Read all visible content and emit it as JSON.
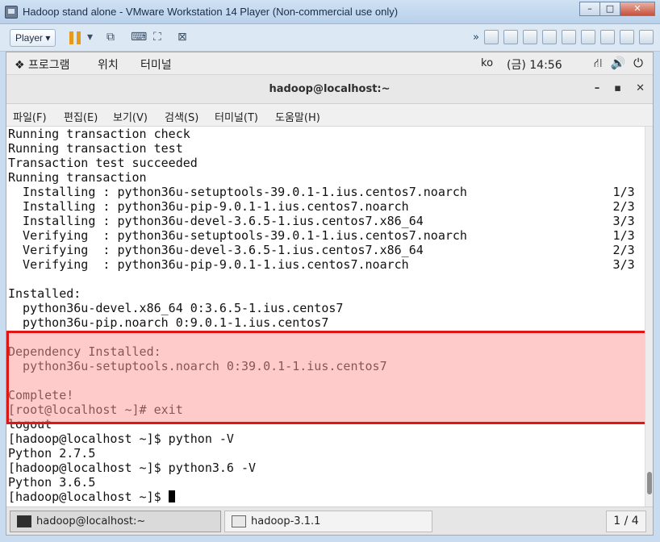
{
  "vm_window": {
    "title": "Hadoop stand alone - VMware Workstation 14 Player (Non-commercial use only)",
    "minimize": "–",
    "maximize": "□",
    "close": "✕"
  },
  "vm_toolbar": {
    "player_menu": "Player ▾"
  },
  "gnome_panel": {
    "applications": "프로그램",
    "places": "위치",
    "terminal": "터미널",
    "keyboard_layout": "ko",
    "clock": "(금) 14:56"
  },
  "terminal_window": {
    "title": "hadoop@localhost:~",
    "minimize": "–",
    "maximize": "▪",
    "close": "✕",
    "menu": [
      "파일(F)",
      "편집(E)",
      "보기(V)",
      "검색(S)",
      "터미널(T)",
      "도움말(H)"
    ]
  },
  "terminal_lines": [
    "Running transaction check",
    "Running transaction test",
    "Transaction test succeeded",
    "Running transaction",
    "  Installing : python36u-setuptools-39.0.1-1.ius.centos7.noarch                    1/3",
    "  Installing : python36u-pip-9.0.1-1.ius.centos7.noarch                            2/3",
    "  Installing : python36u-devel-3.6.5-1.ius.centos7.x86_64                          3/3",
    "  Verifying  : python36u-setuptools-39.0.1-1.ius.centos7.noarch                    1/3",
    "  Verifying  : python36u-devel-3.6.5-1.ius.centos7.x86_64                          2/3",
    "  Verifying  : python36u-pip-9.0.1-1.ius.centos7.noarch                            3/3",
    "",
    "Installed:",
    "  python36u-devel.x86_64 0:3.6.5-1.ius.centos7",
    "  python36u-pip.noarch 0:9.0.1-1.ius.centos7",
    "",
    "Dependency Installed:",
    "  python36u-setuptools.noarch 0:39.0.1-1.ius.centos7",
    "",
    "Complete!",
    "[root@localhost ~]# exit",
    "logout",
    "[hadoop@localhost ~]$ python -V",
    "Python 2.7.5",
    "[hadoop@localhost ~]$ python3.6 -V",
    "Python 3.6.5"
  ],
  "prompt_line": "[hadoop@localhost ~]$ ",
  "taskbar": {
    "items": [
      "hadoop@localhost:~",
      "hadoop-3.1.1"
    ],
    "pager": "1 / 4"
  }
}
